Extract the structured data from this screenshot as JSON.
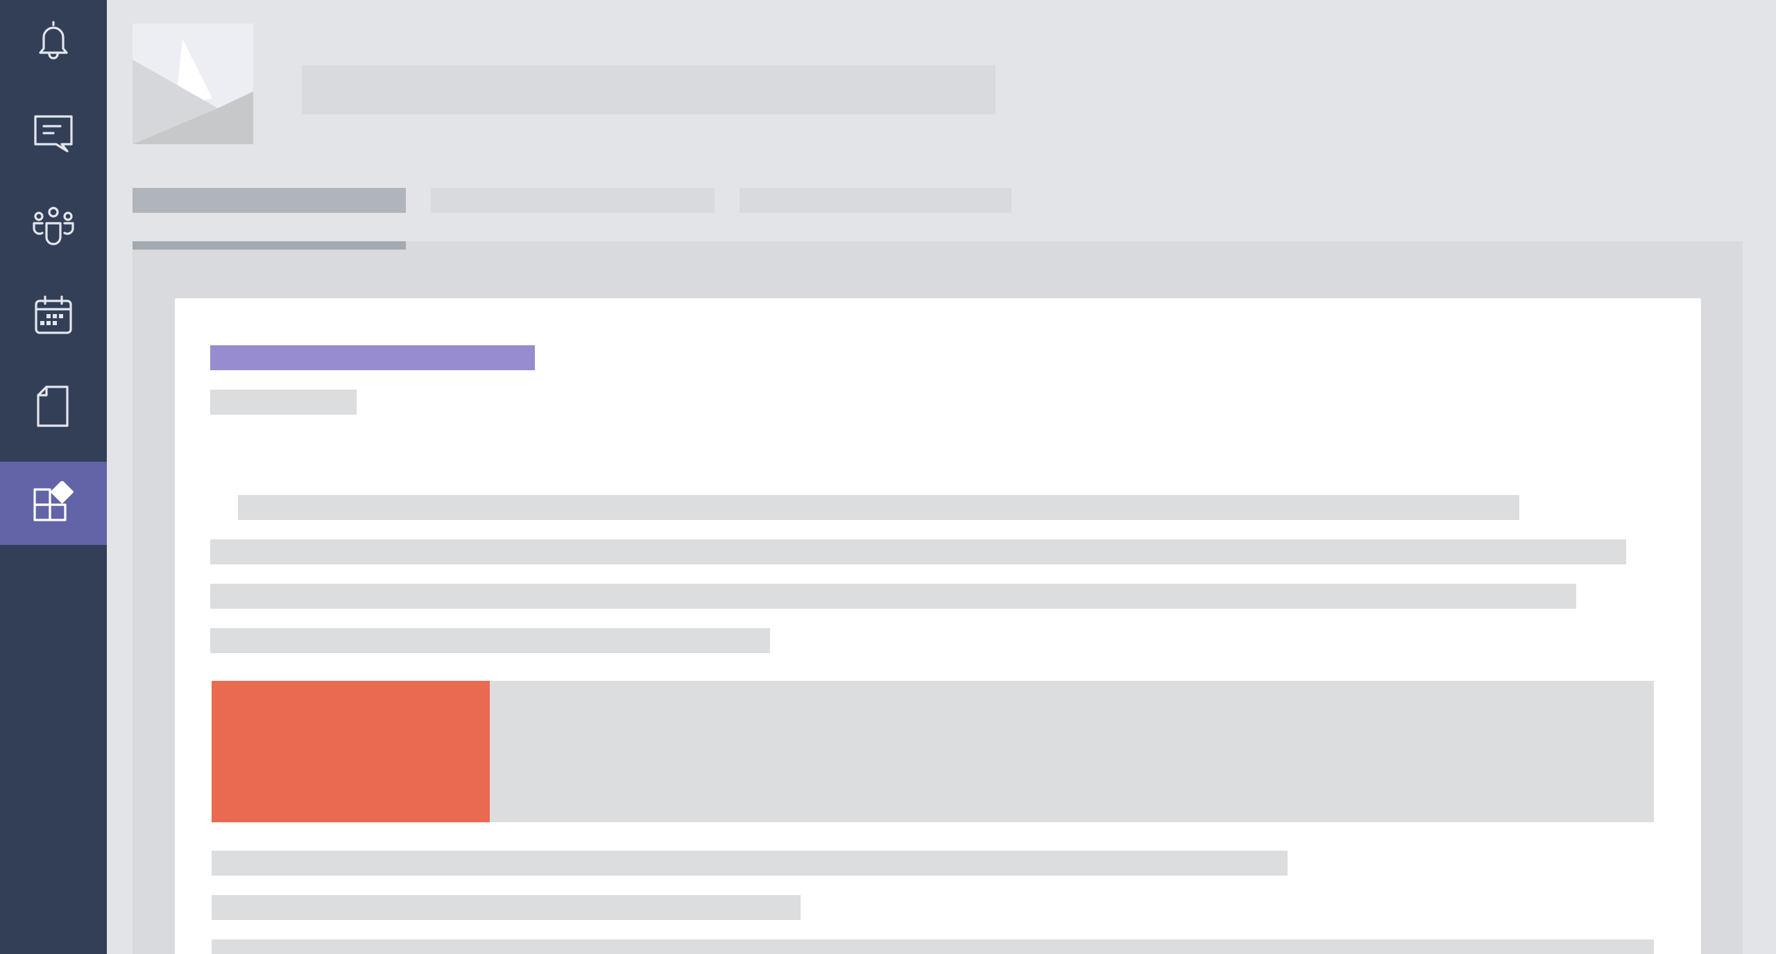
{
  "rail": {
    "items": [
      {
        "icon": "bell-icon",
        "active": false
      },
      {
        "icon": "chat-icon",
        "active": false
      },
      {
        "icon": "teams-icon",
        "active": false
      },
      {
        "icon": "calendar-icon",
        "active": false
      },
      {
        "icon": "files-icon",
        "active": false
      },
      {
        "icon": "apps-icon",
        "active": true
      }
    ],
    "background_color": "#323f57",
    "active_color": "#6264a7"
  },
  "header": {
    "logo_icon": "image-placeholder-icon"
  },
  "tabs": [
    {
      "state": "active"
    },
    {
      "state": "inactive"
    },
    {
      "state": "inactive"
    }
  ],
  "card": {
    "heading_color": "#978ccf",
    "progress": {
      "value": 0.193,
      "fill_color": "#ea6a51"
    }
  }
}
